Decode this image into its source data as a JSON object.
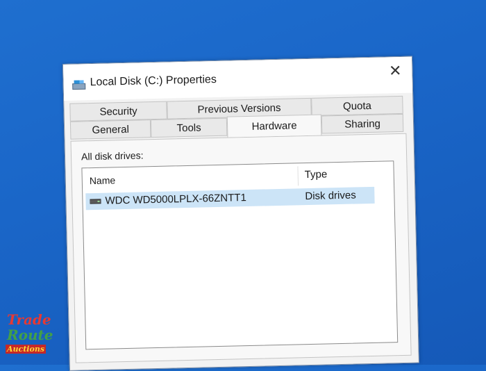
{
  "window": {
    "title": "Local Disk (C:) Properties",
    "close_symbol": "✕"
  },
  "tabs": {
    "row1": [
      "Security",
      "Previous Versions",
      "Quota"
    ],
    "row2": [
      "General",
      "Tools",
      "Hardware",
      "Sharing"
    ],
    "active": "Hardware"
  },
  "hardware": {
    "list_label": "All disk drives:",
    "columns": {
      "name": "Name",
      "type": "Type"
    },
    "rows": [
      {
        "name": "WDC WD5000LPLX-66ZNTT1",
        "type": "Disk drives",
        "icon": "disk-drive-icon",
        "selected": true
      }
    ]
  },
  "watermark": {
    "line1": "Trade",
    "line2": "Route",
    "line3": "Auctions",
    "colors": [
      "#e53935",
      "#43a047",
      "#fdd835",
      "#1e88e5"
    ]
  },
  "colors": {
    "desktop": "#1a66c8",
    "selection": "#cce4f7"
  }
}
